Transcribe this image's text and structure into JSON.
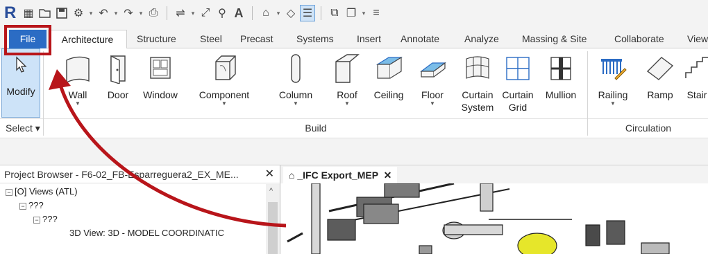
{
  "qat": {
    "logo": "R",
    "icons": [
      "revit-logo",
      "info-icon",
      "open-icon",
      "save-icon",
      "sync-icon",
      "undo-icon",
      "redo-icon",
      "print-icon",
      "measure-icon",
      "dimension-icon",
      "tag-icon",
      "text-icon",
      "3d-view-icon",
      "section-icon",
      "thin-lines-icon",
      "close-hidden-icon",
      "switch-windows-icon",
      "customize-icon"
    ]
  },
  "tabs": {
    "file": "File",
    "items": [
      "Architecture",
      "Structure",
      "Steel",
      "Precast",
      "Systems",
      "Insert",
      "Annotate",
      "Analyze",
      "Massing & Site",
      "Collaborate",
      "View"
    ]
  },
  "ribbon": {
    "modify": "Modify",
    "build": [
      {
        "label": "Wall",
        "icon": "wall-icon"
      },
      {
        "label": "Door",
        "icon": "door-icon"
      },
      {
        "label": "Window",
        "icon": "window-icon"
      },
      {
        "label": "Component",
        "icon": "component-icon"
      },
      {
        "label": "Column",
        "icon": "column-icon"
      },
      {
        "label": "Roof",
        "icon": "roof-icon"
      },
      {
        "label": "Ceiling",
        "icon": "ceiling-icon"
      },
      {
        "label": "Floor",
        "icon": "floor-icon"
      },
      {
        "label": "Curtain System",
        "line1": "Curtain",
        "line2": "System",
        "icon": "curtain-system-icon"
      },
      {
        "label": "Curtain Grid",
        "line1": "Curtain",
        "line2": "Grid",
        "icon": "curtain-grid-icon"
      },
      {
        "label": "Mullion",
        "icon": "mullion-icon"
      }
    ],
    "circulation": [
      {
        "label": "Railing",
        "icon": "railing-icon"
      },
      {
        "label": "Ramp",
        "icon": "ramp-icon"
      },
      {
        "label": "Stair",
        "icon": "stair-icon"
      }
    ],
    "panels": {
      "select": "Select",
      "build": "Build",
      "circulation": "Circulation"
    }
  },
  "browser": {
    "title": "Project Browser - F6-02_FB-Esparreguera2_EX_ME...",
    "nodes": [
      {
        "label": "Views (ATL)",
        "icon": "views-icon"
      },
      {
        "label": "???"
      },
      {
        "label": "???"
      },
      {
        "label": "3D View: 3D - MODEL COORDINATIC"
      }
    ]
  },
  "view": {
    "tab_label": "_IFC Export_MEP"
  },
  "colors": {
    "accent": "#2b6cc4",
    "annotation": "#b8151a",
    "modify_bg": "#cde3f8"
  }
}
